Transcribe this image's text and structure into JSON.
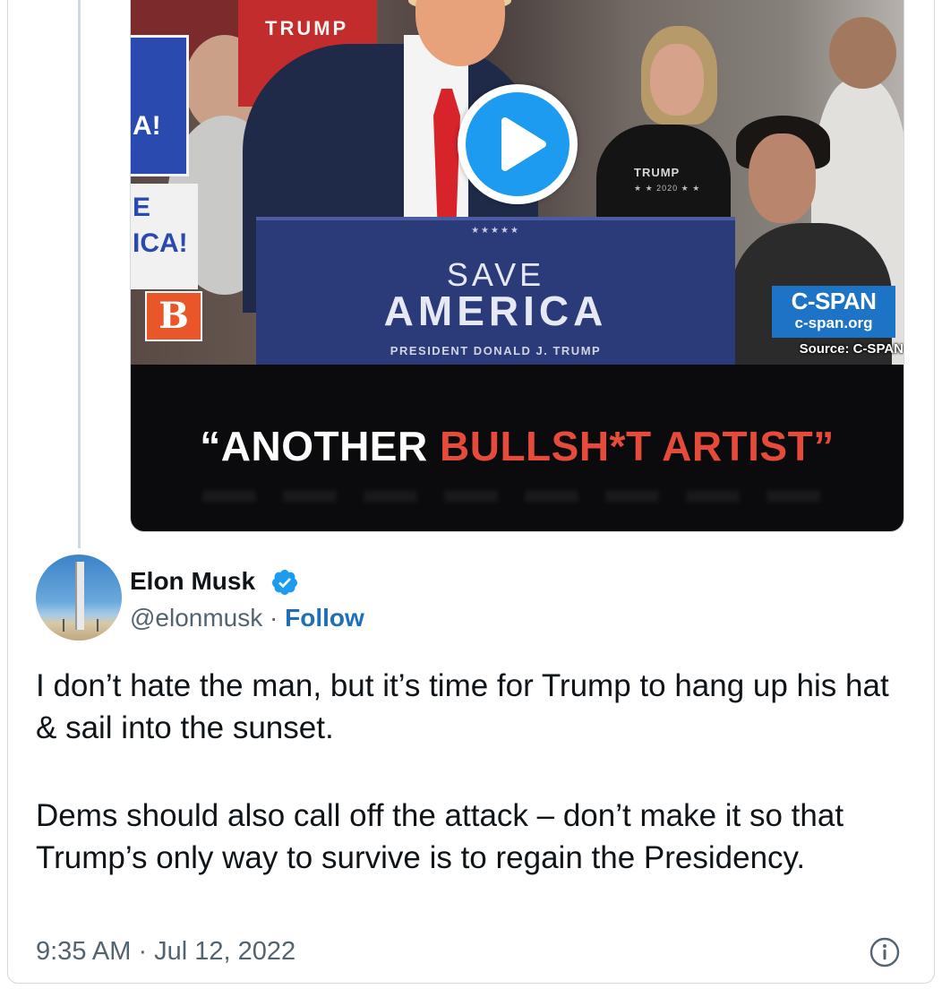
{
  "media": {
    "caption_part1": "“ANOTHER ",
    "caption_part2": "BULLSH*T ARTIST”",
    "podium_stars": "★★★★★",
    "podium_line1": "SAVE",
    "podium_line2": "AMERICA",
    "podium_line3": "PRESIDENT DONALD J. TRUMP",
    "shirt_text": "TRUMP",
    "shirt_subtext": "★ ★ 2020 ★ ★",
    "sign_text_top": "A!",
    "sign_text_mid1": "E",
    "sign_text_mid2": "ICA!",
    "logo_letter": "B",
    "network_name": "C-SPAN",
    "network_url": "c-span.org",
    "source_text": "Source: C-SPAN",
    "play_icon": "play-icon",
    "colors": {
      "play": "#1d9bf0",
      "caption_red": "#e64a3b",
      "cspan_blue": "#1d73c6",
      "logo_orange": "#e8562a"
    }
  },
  "author": {
    "name": "Elon Musk",
    "handle": "@elonmusk",
    "separator": " · ",
    "follow_label": "Follow",
    "verified_icon": "verified-badge-icon"
  },
  "tweet": {
    "paragraph1": "I don’t hate the man, but it’s time for Trump to hang up his hat & sail into the sunset.",
    "paragraph2": "Dems should also call off the attack – don’t make it so that Trump’s only way to survive is to regain the Presidency.",
    "timestamp": "9:35 AM · Jul 12, 2022"
  },
  "colors": {
    "accent": "#1d9bf0",
    "follow": "#1d70b8",
    "muted": "#536471",
    "text": "#0f1419",
    "border": "#cfd9de"
  }
}
